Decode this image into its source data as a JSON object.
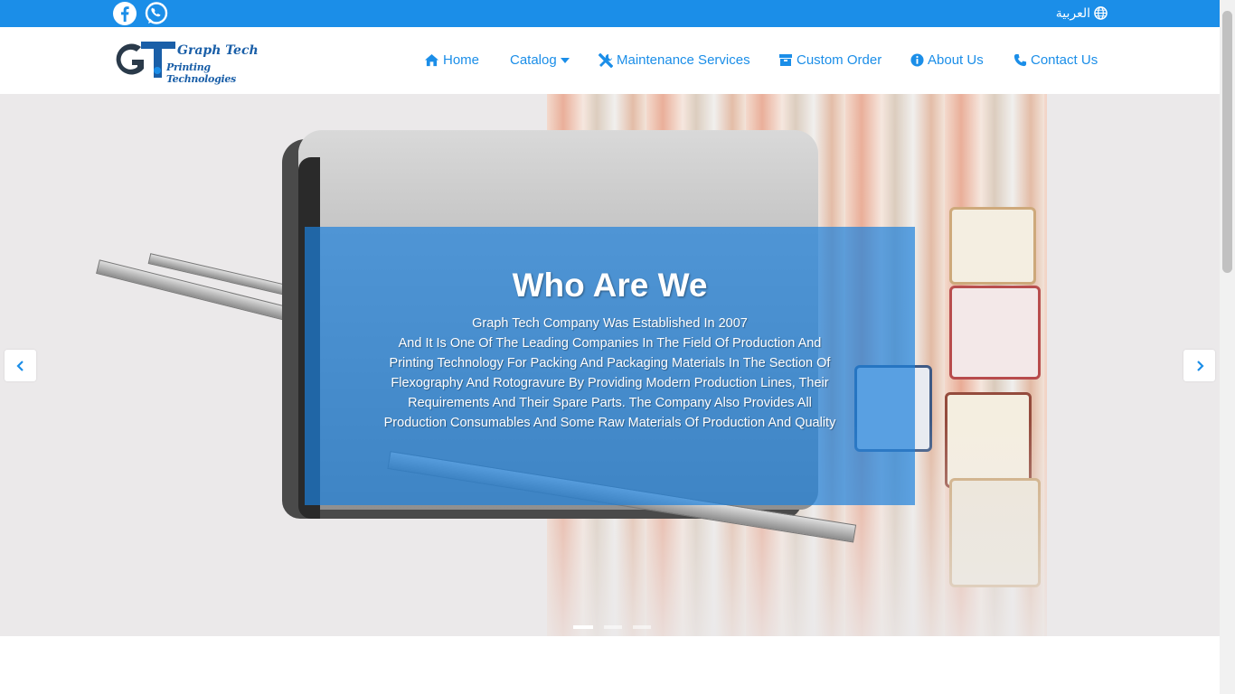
{
  "topbar": {
    "language_label": "العربية",
    "social": [
      "facebook-icon",
      "whatsapp-icon"
    ]
  },
  "brand": {
    "mark": "GT",
    "line1": "Graph Tech",
    "line2": "Printing Technologies"
  },
  "nav": {
    "items": [
      {
        "label": "Home",
        "icon": "home-icon"
      },
      {
        "label": "Catalog",
        "icon": "caret-down-icon"
      },
      {
        "label": "Maintenance Services",
        "icon": "tools-icon"
      },
      {
        "label": "Custom Order",
        "icon": "box-icon"
      },
      {
        "label": "About Us",
        "icon": "info-circle-icon"
      },
      {
        "label": "Contact Us",
        "icon": "phone-icon"
      }
    ]
  },
  "hero": {
    "title": "Who Are We",
    "line1": "Graph Tech Company Was Established In 2007",
    "body": "And It Is One Of The Leading Companies In The Field Of Production And Printing Technology For Packing And Packaging Materials In The Section Of Flexography And Rotogravure By Providing Modern Production Lines, Their Requirements And Their Spare Parts. The Company Also Provides All Production Consumables And Some Raw Materials Of Production And Quality",
    "active_slide": 1,
    "slide_count": 3
  },
  "colors": {
    "accent": "#1b8ee8",
    "overlay": "#1d80db"
  }
}
